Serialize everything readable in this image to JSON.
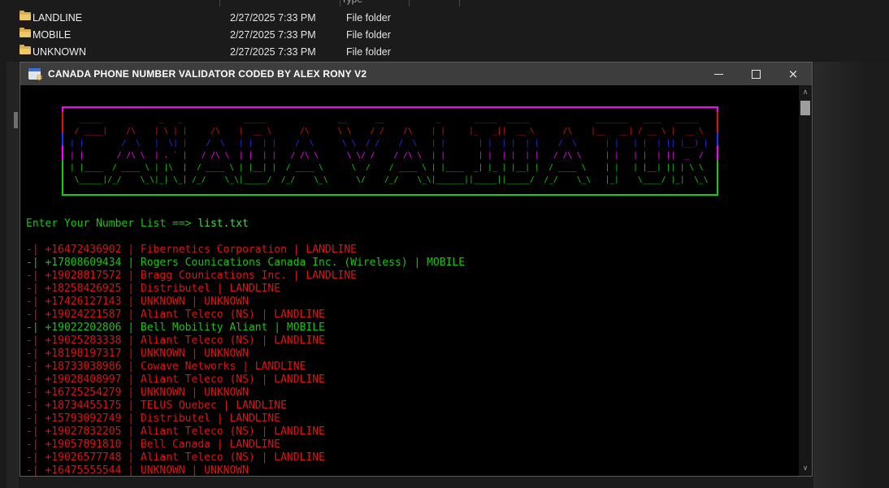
{
  "colors": {
    "red": "#de1212",
    "green": "#16c60c",
    "bright_green": "#3ae23a",
    "blue": "#2a2aff",
    "magenta": "#ff00ff",
    "art_green": "#0ed00e",
    "title_bar": "#3d3d3d",
    "folder_yellow": "#dcaf4c"
  },
  "explorer": {
    "partial_header": "Type",
    "rows": [
      {
        "name": "LANDLINE",
        "date": "2/27/2025 7:33 PM",
        "type": "File folder"
      },
      {
        "name": "MOBILE",
        "date": "2/27/2025 7:33 PM",
        "type": "File folder"
      },
      {
        "name": "UNKNOWN",
        "date": "2/27/2025 7:33 PM",
        "type": "File folder"
      }
    ]
  },
  "console_window": {
    "title": "CANADA PHONE NUMBER VALIDATOR CODED BY ALEX RONY V2",
    "controls": {
      "close_glyph": "×"
    },
    "banner": {
      "text": "CANADA VALIDATOR",
      "line_colors": [
        "red",
        "red",
        "blue",
        "magenta",
        "art_green",
        "art_green"
      ],
      "sequence": [
        "C",
        "A",
        "N",
        "A",
        "D",
        "A",
        " ",
        "V",
        "A",
        "L",
        "I",
        "D",
        "A",
        "T",
        "O",
        "R"
      ],
      "letters": {
        " ": [
          "  ",
          "  ",
          "  ",
          "  ",
          "  ",
          "  "
        ],
        "C": [
          "  _____ ",
          " / ____|",
          "| |     ",
          "| |     ",
          "| |____ ",
          " \\_____|"
        ],
        "A": [
          "          ",
          "    /\\    ",
          "   /  \\   ",
          "  / /\\ \\  ",
          " / ____ \\ ",
          "/_/    \\_\\"
        ],
        "N": [
          " _   _  ",
          "| \\ | | ",
          "|  \\| | ",
          "| . ` | ",
          "| |\\  | ",
          "|_| \\_| "
        ],
        "D": [
          " _____   ",
          "|  __ \\  ",
          "| |  | | ",
          "| |  | | ",
          "| |__| | ",
          "|_____/  "
        ],
        "V": [
          "__      __",
          "\\ \\    / /",
          " \\ \\  / / ",
          "  \\ \\/ /  ",
          "   \\  /   ",
          "    \\/    "
        ],
        "L": [
          " _      ",
          "| |     ",
          "| |     ",
          "| |     ",
          "| |____ ",
          "|______|"
        ],
        "I": [
          " _____ ",
          "|_   _|",
          "  | |  ",
          "  | |  ",
          " _| |_ ",
          "|_____|"
        ],
        "T": [
          " _______ ",
          "|__   __|",
          "   | |   ",
          "   | |   ",
          "   | |   ",
          "   |_|   "
        ],
        "O": [
          "  ____  ",
          " / __ \\ ",
          "| |  | |",
          "| |  | |",
          "| |__| |",
          " \\____/ "
        ],
        "R": [
          " _____  ",
          "|  __ \\ ",
          "| |__) |",
          "|  _  / ",
          "| | \\ \\ ",
          "|_|  \\_\\"
        ]
      }
    },
    "prompt_label": "Enter Your Number List ==>",
    "prompt_value": "list.txt",
    "result_format": {
      "prefix": "-|",
      "separator": "|"
    },
    "results": [
      {
        "number": "+16472436902",
        "carrier": "Fibernetics Corporation",
        "line_type": "LANDLINE"
      },
      {
        "number": "+17808609434",
        "carrier": "Rogers Counications Canada Inc. (Wireless)",
        "line_type": "MOBILE"
      },
      {
        "number": "+19028817572",
        "carrier": "Bragg Counications Inc.",
        "line_type": "LANDLINE"
      },
      {
        "number": "+18258426925",
        "carrier": "Distributel",
        "line_type": "LANDLINE"
      },
      {
        "number": "+17426127143",
        "carrier": "UNKNOWN",
        "line_type": "UNKNOWN"
      },
      {
        "number": "+19024221587",
        "carrier": "Aliant Teleco (NS)",
        "line_type": "LANDLINE"
      },
      {
        "number": "+19022202806",
        "carrier": "Bell Mobility Aliant",
        "line_type": "MOBILE"
      },
      {
        "number": "+19025283338",
        "carrier": "Aliant Teleco (NS)",
        "line_type": "LANDLINE"
      },
      {
        "number": "+18198197317",
        "carrier": "UNKNOWN",
        "line_type": "UNKNOWN"
      },
      {
        "number": "+18733038986",
        "carrier": "Cowave Networks",
        "line_type": "LANDLINE"
      },
      {
        "number": "+19028408997",
        "carrier": "Aliant Teleco (NS)",
        "line_type": "LANDLINE"
      },
      {
        "number": "+16725254279",
        "carrier": "UNKNOWN",
        "line_type": "UNKNOWN"
      },
      {
        "number": "+18734455175",
        "carrier": "TELUS Quebec",
        "line_type": "LANDLINE"
      },
      {
        "number": "+15793092749",
        "carrier": "Distributel",
        "line_type": "LANDLINE"
      },
      {
        "number": "+19027832205",
        "carrier": "Aliant Teleco (NS)",
        "line_type": "LANDLINE"
      },
      {
        "number": "+19057891810",
        "carrier": "Bell Canada",
        "line_type": "LANDLINE"
      },
      {
        "number": "+19026577748",
        "carrier": "Aliant Teleco (NS)",
        "line_type": "LANDLINE"
      },
      {
        "number": "+16475555544",
        "carrier": "UNKNOWN",
        "line_type": "UNKNOWN"
      }
    ]
  }
}
